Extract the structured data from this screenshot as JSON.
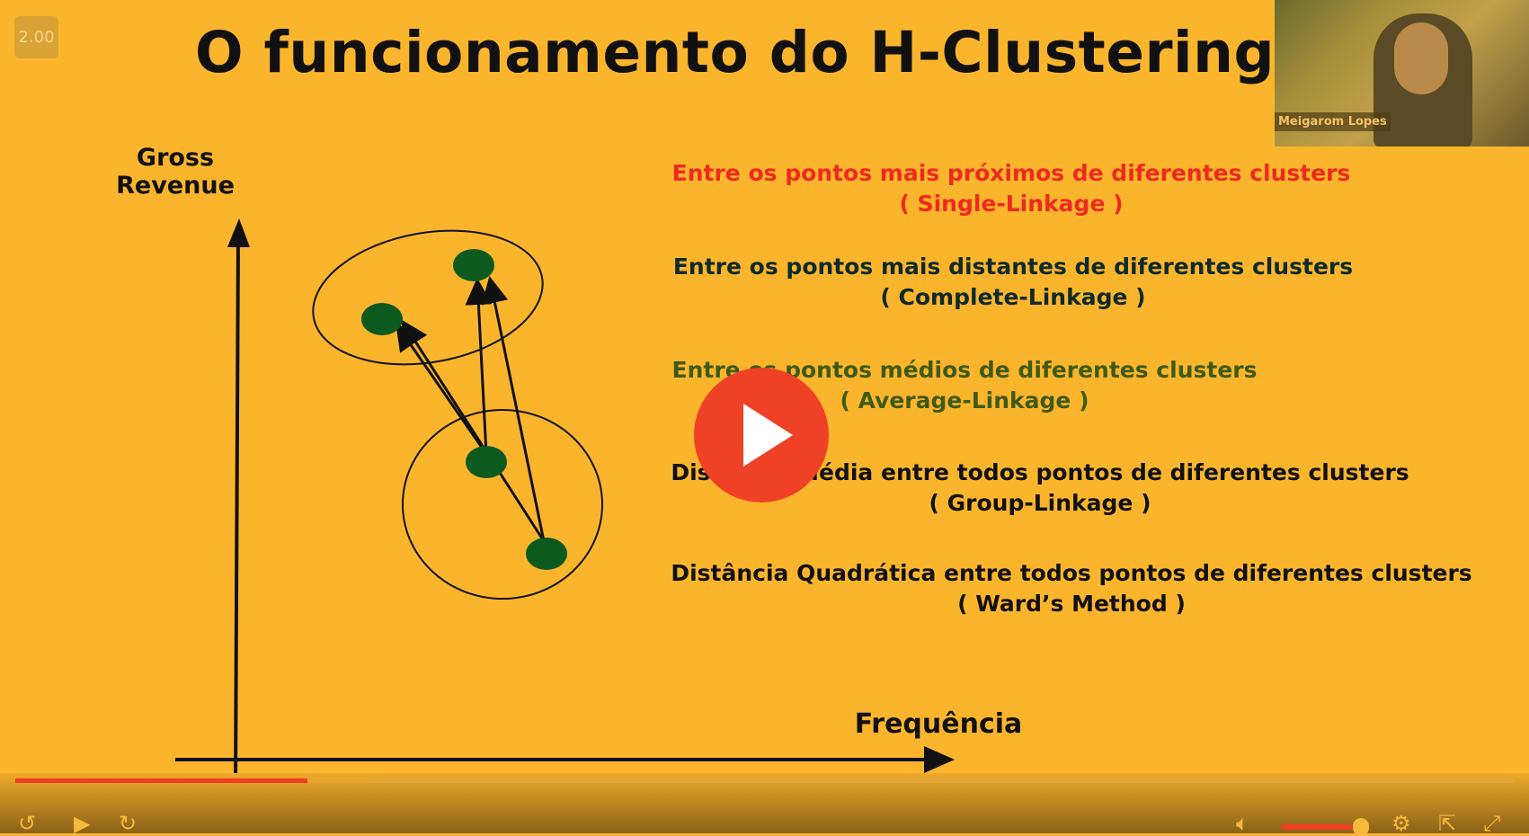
{
  "slide": {
    "title": "O funcionamento do H-Clustering",
    "y_axis_label_1": "Gross",
    "y_axis_label_2": "Revenue",
    "x_axis_label": "Frequência",
    "methods": [
      {
        "line1": "Entre os pontos mais próximos de diferentes clusters",
        "line2": "( Single-Linkage )",
        "color": "#ee2a1e"
      },
      {
        "line1": "Entre os pontos mais distantes de diferentes clusters",
        "line2": "( Complete-Linkage )",
        "color": "#0f2a2a"
      },
      {
        "line1": "Entre os pontos médios de diferentes clusters",
        "line2": "( Average-Linkage )",
        "color": "#3f5a14"
      },
      {
        "line1": "Distância Média entre todos pontos de diferentes clusters",
        "line2": "( Group-Linkage )",
        "color": "#111111"
      },
      {
        "line1": "Distância Quadrática entre todos pontos de diferentes clusters",
        "line2": "( Ward’s Method )",
        "color": "#111111"
      }
    ]
  },
  "player": {
    "speed": "2.00",
    "presenter_name": "Meigarom Lopes",
    "progress_percent": 19.5,
    "buffered_percent": 23.7,
    "volume_percent": 85,
    "accent": "#f03d24"
  }
}
